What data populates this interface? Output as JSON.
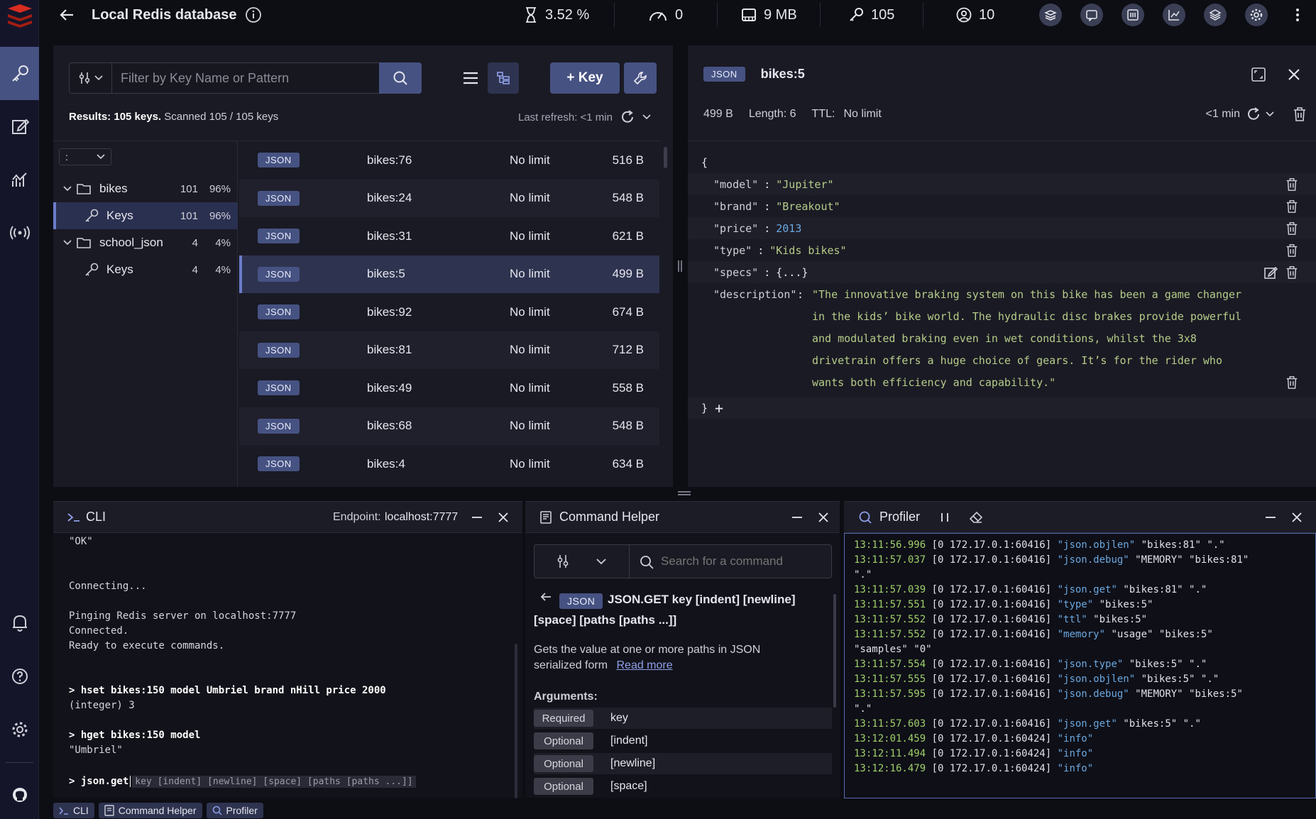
{
  "topbar": {
    "title": "Local Redis database",
    "cpu": "3.52 %",
    "ops": "0",
    "memory": "9 MB",
    "keys": "105",
    "clients": "10"
  },
  "browser": {
    "filter_placeholder": "Filter by Key Name or Pattern",
    "add_key_label": "+ Key",
    "results_bold": "Results: 105 keys.",
    "results_rest": " Scanned 105 / 105 keys",
    "last_refresh": "Last refresh: <1 min",
    "delimiter": ":",
    "tree": [
      {
        "label": "bikes",
        "count": "101",
        "pct": "96%"
      },
      {
        "label": "Keys",
        "count": "101",
        "pct": "96%"
      },
      {
        "label": "school_json",
        "count": "4",
        "pct": "4%"
      },
      {
        "label": "Keys",
        "count": "4",
        "pct": "4%"
      }
    ],
    "keys": [
      {
        "type": "JSON",
        "name": "bikes:76",
        "ttl": "No limit",
        "size": "516 B"
      },
      {
        "type": "JSON",
        "name": "bikes:24",
        "ttl": "No limit",
        "size": "548 B"
      },
      {
        "type": "JSON",
        "name": "bikes:31",
        "ttl": "No limit",
        "size": "621 B"
      },
      {
        "type": "JSON",
        "name": "bikes:5",
        "ttl": "No limit",
        "size": "499 B"
      },
      {
        "type": "JSON",
        "name": "bikes:92",
        "ttl": "No limit",
        "size": "674 B"
      },
      {
        "type": "JSON",
        "name": "bikes:81",
        "ttl": "No limit",
        "size": "712 B"
      },
      {
        "type": "JSON",
        "name": "bikes:49",
        "ttl": "No limit",
        "size": "558 B"
      },
      {
        "type": "JSON",
        "name": "bikes:68",
        "ttl": "No limit",
        "size": "548 B"
      },
      {
        "type": "JSON",
        "name": "bikes:4",
        "ttl": "No limit",
        "size": "634 B"
      }
    ]
  },
  "details": {
    "type": "JSON",
    "key": "bikes:5",
    "size": "499 B",
    "length": "Length: 6",
    "ttl_label": "TTL:",
    "ttl_value": "No limit",
    "refresh": "<1 min",
    "open_brace": "{",
    "close_brace": "}",
    "add": "+",
    "fields": {
      "model_k": "\"model\"",
      "model_v": "\"Jupiter\"",
      "brand_k": "\"brand\"",
      "brand_v": "\"Breakout\"",
      "price_k": "\"price\"",
      "price_v": "2013",
      "type_k": "\"type\"",
      "type_v": "\"Kids bikes\"",
      "specs_k": "\"specs\"",
      "specs_v": "{...}",
      "desc_k": "\"description\"",
      "desc_lines": [
        "\"The innovative braking system on this bike has been a game changer",
        "in the kids’ bike world. The hydraulic disc brakes provide powerful",
        "and modulated braking even in wet conditions, whilst the 3x8",
        "drivetrain offers a huge choice of gears. It’s for the rider who",
        "wants both efficiency and capability.\""
      ]
    }
  },
  "cli": {
    "title": "CLI",
    "endpoint_label": "Endpoint:",
    "endpoint": "localhost:7777",
    "lines": [
      "\"OK\"",
      "",
      "",
      "Connecting...",
      "",
      "Pinging Redis server on localhost:7777",
      "Connected.",
      "Ready to execute commands.",
      "",
      "",
      "> hset bikes:150 model Umbriel brand nHill price 2000",
      "(integer) 3",
      "",
      "> hget bikes:150 model",
      "\"Umbriel\"",
      ""
    ],
    "prompt": "> json.get",
    "hint": "key [indent] [newline] [space] [paths [paths ...]]"
  },
  "helper": {
    "title": "Command Helper",
    "search_placeholder": "Search for a command",
    "group": "JSON",
    "syntax1": "JSON.GET key [indent] [newline]",
    "syntax2": "[space] [paths [paths ...]]",
    "desc1": "Gets the value at one or more paths in JSON",
    "desc2": "serialized form",
    "read_more": "Read more",
    "arguments_label": "Arguments:",
    "args": [
      {
        "tag": "Required",
        "name": "key"
      },
      {
        "tag": "Optional",
        "name": "[indent]"
      },
      {
        "tag": "Optional",
        "name": "[newline]"
      },
      {
        "tag": "Optional",
        "name": "[space]"
      }
    ]
  },
  "profiler": {
    "title": "Profiler",
    "lines": [
      {
        "ts": "13:11:56.996",
        "src": " [0 172.17.0.1:60416] ",
        "cmd": "\"json.objlen\"",
        "rest": " \"bikes:81\" \".\""
      },
      {
        "ts": "13:11:57.037",
        "src": " [0 172.17.0.1:60416] ",
        "cmd": "\"json.debug\"",
        "rest": " \"MEMORY\" \"bikes:81\""
      },
      {
        "ts": "",
        "src": "",
        "cmd": "",
        "rest": "\".\""
      },
      {
        "ts": "13:11:57.039",
        "src": " [0 172.17.0.1:60416] ",
        "cmd": "\"json.get\"",
        "rest": " \"bikes:81\" \".\""
      },
      {
        "ts": "13:11:57.551",
        "src": " [0 172.17.0.1:60416] ",
        "cmd": "\"type\"",
        "rest": " \"bikes:5\""
      },
      {
        "ts": "13:11:57.552",
        "src": " [0 172.17.0.1:60416] ",
        "cmd": "\"ttl\"",
        "rest": " \"bikes:5\""
      },
      {
        "ts": "13:11:57.552",
        "src": " [0 172.17.0.1:60416] ",
        "cmd": "\"memory\"",
        "rest": " \"usage\" \"bikes:5\""
      },
      {
        "ts": "",
        "src": "",
        "cmd": "",
        "rest": "\"samples\" \"0\""
      },
      {
        "ts": "13:11:57.554",
        "src": " [0 172.17.0.1:60416] ",
        "cmd": "\"json.type\"",
        "rest": " \"bikes:5\" \".\""
      },
      {
        "ts": "13:11:57.555",
        "src": " [0 172.17.0.1:60416] ",
        "cmd": "\"json.objlen\"",
        "rest": " \"bikes:5\" \".\""
      },
      {
        "ts": "13:11:57.595",
        "src": " [0 172.17.0.1:60416] ",
        "cmd": "\"json.debug\"",
        "rest": " \"MEMORY\" \"bikes:5\""
      },
      {
        "ts": "",
        "src": "",
        "cmd": "",
        "rest": "\".\""
      },
      {
        "ts": "13:11:57.603",
        "src": " [0 172.17.0.1:60416] ",
        "cmd": "\"json.get\"",
        "rest": " \"bikes:5\" \".\""
      },
      {
        "ts": "13:12:01.459",
        "src": " [0 172.17.0.1:60424] ",
        "cmd": "\"info\"",
        "rest": ""
      },
      {
        "ts": "13:12:11.494",
        "src": " [0 172.17.0.1:60424] ",
        "cmd": "\"info\"",
        "rest": ""
      },
      {
        "ts": "13:12:16.479",
        "src": " [0 172.17.0.1:60424] ",
        "cmd": "\"info\"",
        "rest": ""
      }
    ]
  },
  "footer": {
    "cli": "CLI",
    "helper": "Command Helper",
    "profiler": "Profiler"
  },
  "colors": {
    "accent": "#465282",
    "background": "#0d0d14",
    "panel": "#1a1a24",
    "timestamp": "#9fd06a",
    "command": "#6aa8e0",
    "string_value": "#b5cc88"
  }
}
